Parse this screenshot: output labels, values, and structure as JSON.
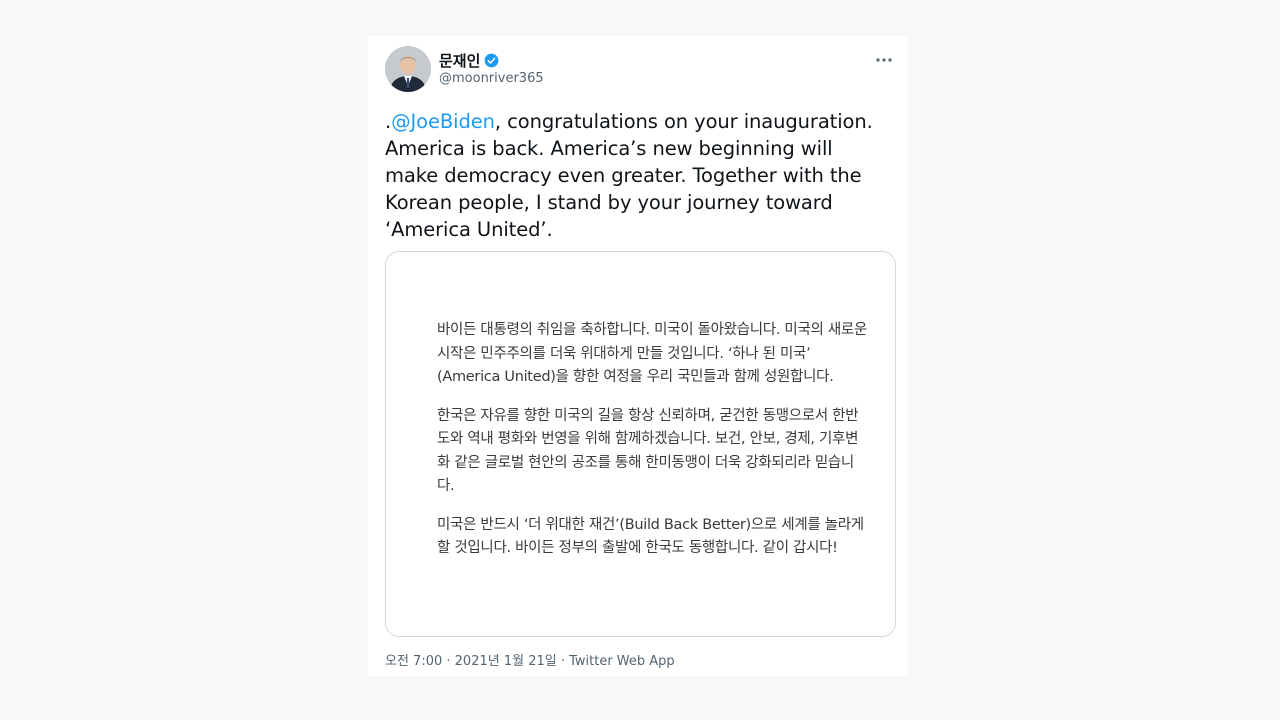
{
  "author": {
    "display_name": "문재인",
    "handle": "@moonriver365",
    "verified": true
  },
  "tweet": {
    "prefix": ".",
    "mention": "@JoeBiden",
    "body": ", congratulations on your inauguration. America is back. America’s new beginning will make democracy even greater. Together with the Korean people, I stand by your journey toward ‘America United’."
  },
  "statement": {
    "paragraphs": [
      "바이든 대통령의 취임을 축하합니다. 미국이 돌아왔습니다. 미국의 새로운 시작은 민주주의를 더욱 위대하게 만들 것입니다. ‘하나 된 미국’ (America United)을 향한 여정을 우리 국민들과 함께 성원합니다.",
      "한국은 자유를 향한 미국의 길을 항상 신뢰하며, 굳건한 동맹으로서 한반도와 역내 평화와 번영을 위해 함께하겠습니다. 보건, 안보, 경제, 기후변화 같은 글로벌 현안의 공조를 통해 한미동맹이 더욱 강화되리라 믿습니다.",
      "미국은 반드시 ‘더 위대한 재건’(Build Back Better)으로 세계를 놀라게 할 것입니다. 바이든 정부의 출발에 한국도 동행합니다. 같이 갑시다!"
    ]
  },
  "meta": {
    "time": "오전 7:00",
    "separator": " · ",
    "date": "2021년 1월 21일",
    "source": "Twitter Web App"
  },
  "colors": {
    "link": "#1d9bf0",
    "verified": "#1d9bf0",
    "secondary_text": "#536471"
  },
  "icons": {
    "verified": "verified-badge-icon",
    "more": "more-options-icon"
  }
}
